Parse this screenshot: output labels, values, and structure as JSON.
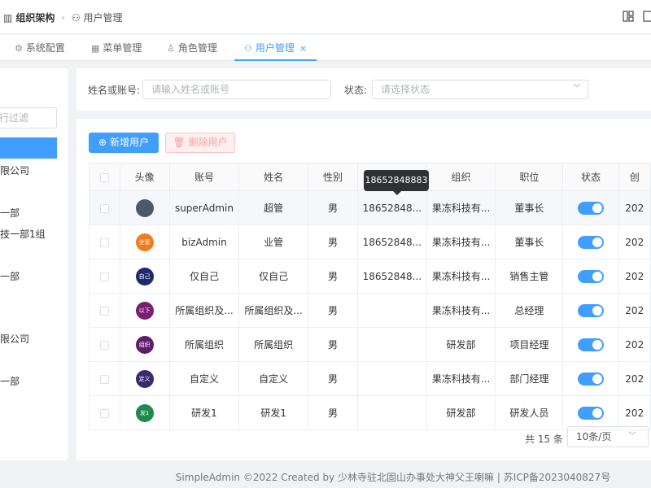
{
  "breadcrumb": {
    "root": "组织架构",
    "current": "用户管理"
  },
  "tabs": [
    {
      "label": "系统配置",
      "icon": "gear-icon"
    },
    {
      "label": "菜单管理",
      "icon": "grid-icon"
    },
    {
      "label": "角色管理",
      "icon": "user-icon"
    },
    {
      "label": "用户管理",
      "icon": "users-icon",
      "close": "×"
    }
  ],
  "tree": {
    "filter_placeholder": "行过滤",
    "items": [
      "限公司",
      "一部",
      "技一部1组",
      "一部",
      "限公司",
      "一部"
    ]
  },
  "search": {
    "name_label": "姓名或账号:",
    "name_placeholder": "请输入姓名或账号",
    "status_label": "状态:",
    "status_placeholder": "请选择状态"
  },
  "actions": {
    "add": "新增用户",
    "delete": "删除用户"
  },
  "table": {
    "columns": [
      "头像",
      "账号",
      "姓名",
      "性别",
      "",
      "组织",
      "职位",
      "状态",
      "创"
    ],
    "rows": [
      {
        "avatar": "",
        "avatar_color": "#4a5a6a",
        "account": "superAdmin",
        "name": "超管",
        "gender": "男",
        "phone": "18652848...",
        "org": "果冻科技有...",
        "position": "董事长",
        "status": "1",
        "created": "202"
      },
      {
        "avatar": "业管",
        "avatar_color": "#f07c1e",
        "account": "bizAdmin",
        "name": "业管",
        "gender": "男",
        "phone": "18652848...",
        "org": "果冻科技有...",
        "position": "董事长",
        "status": "1",
        "created": "202"
      },
      {
        "avatar": "自己",
        "avatar_color": "#1e2a6e",
        "account": "仅自己",
        "name": "仅自己",
        "gender": "男",
        "phone": "18652848...",
        "org": "果冻科技有...",
        "position": "销售主管",
        "status": "1",
        "created": "202"
      },
      {
        "avatar": "以下",
        "avatar_color": "#7a1e6e",
        "account": "所属组织及...",
        "name": "所属组织及...",
        "gender": "男",
        "phone": "",
        "org": "果冻科技有...",
        "position": "总经理",
        "status": "1",
        "created": "202"
      },
      {
        "avatar": "组织",
        "avatar_color": "#5e1e6e",
        "account": "所属组织",
        "name": "所属组织",
        "gender": "男",
        "phone": "",
        "org": "研发部",
        "position": "项目经理",
        "status": "1",
        "created": "202"
      },
      {
        "avatar": "定义",
        "avatar_color": "#3a2a6e",
        "account": "自定义",
        "name": "自定义",
        "gender": "男",
        "phone": "",
        "org": "果冻科技有...",
        "position": "部门经理",
        "status": "1",
        "created": "202"
      },
      {
        "avatar": "发1",
        "avatar_color": "#1e8a4e",
        "account": "研发1",
        "name": "研发1",
        "gender": "男",
        "phone": "",
        "org": "研发部",
        "position": "研发人员",
        "status": "1",
        "created": "202"
      }
    ]
  },
  "tooltip": "18652848883",
  "pager": {
    "total": "共 15 条",
    "page_size": "10条/页"
  },
  "footer": "SimpleAdmin ©2022 Created by 少林寺驻北固山办事处大神父王喇嘛 | 苏ICP备2023040827号",
  "colors": {
    "primary": "#409eff",
    "danger_light": "#fef0f0"
  }
}
